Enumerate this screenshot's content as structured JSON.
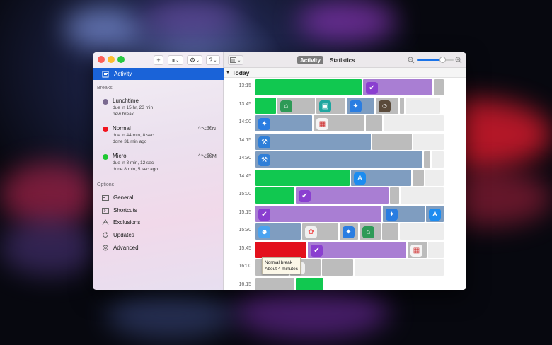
{
  "toolbar": {
    "add_label": "+",
    "pause_label": "⏸",
    "gear_label": "⚙",
    "help_label": "?",
    "chevron": "⌄"
  },
  "sidebar": {
    "activity_label": "Activity",
    "breaks_heading": "Breaks",
    "breaks": [
      {
        "name": "Lunchtime",
        "color": "#7a6a90",
        "line1": "due in 15 hr, 23 min",
        "line2": "new break",
        "shortcut": ""
      },
      {
        "name": "Normal",
        "color": "#f2141e",
        "line1": "due in 44 min, 8 sec",
        "line2": "done 31 min ago",
        "shortcut": "^⌥⌘N"
      },
      {
        "name": "Micro",
        "color": "#1fc832",
        "line1": "due in 8 min, 12 sec",
        "line2": "done 8 min, 5 sec ago",
        "shortcut": "^⌥⌘M"
      }
    ],
    "options_heading": "Options",
    "options": [
      {
        "label": "General",
        "icon": "general-icon"
      },
      {
        "label": "Shortcuts",
        "icon": "shortcuts-icon"
      },
      {
        "label": "Exclusions",
        "icon": "exclusions-icon"
      },
      {
        "label": "Updates",
        "icon": "updates-icon"
      },
      {
        "label": "Advanced",
        "icon": "advanced-icon"
      }
    ]
  },
  "main": {
    "tabs": [
      {
        "label": "Activity",
        "active": true
      },
      {
        "label": "Statistics",
        "active": false
      }
    ],
    "zoom_level": 0.7,
    "day_label": "Today",
    "colors": {
      "green": "#11c850",
      "purple": "#a97ed3",
      "steel": "#7f9dc0",
      "gray": "#bcbcbc",
      "light": "#ededed",
      "red": "#e3101c"
    },
    "rows": [
      {
        "time": "13:15",
        "segments": [
          {
            "c": "green",
            "w": 152
          },
          {
            "c": "purple",
            "w": 100,
            "icon": "tasks-icon"
          },
          {
            "c": "gray",
            "w": 16
          }
        ]
      },
      {
        "time": "13:45",
        "segments": [
          {
            "c": "green",
            "w": 31
          },
          {
            "c": "gray",
            "w": 55,
            "icon": "sourcetree-icon"
          },
          {
            "c": "gray",
            "w": 43,
            "icon": "terminal-icon"
          },
          {
            "c": "steel",
            "w": 41,
            "icon": "safari-icon"
          },
          {
            "c": "gray",
            "w": 34,
            "icon": "robot-icon"
          },
          {
            "c": "gray",
            "w": 8
          },
          {
            "c": "light",
            "w": 51
          }
        ]
      },
      {
        "time": "14:00",
        "segments": [
          {
            "c": "steel",
            "w": 82,
            "icon": "safari-icon"
          },
          {
            "c": "gray",
            "w": 74,
            "icon": "calendar-icon"
          },
          {
            "c": "gray",
            "w": 25
          },
          {
            "c": "light",
            "w": 87
          }
        ]
      },
      {
        "time": "14:15",
        "segments": [
          {
            "c": "steel",
            "w": 165,
            "icon": "xcode-icon"
          },
          {
            "c": "gray",
            "w": 58
          },
          {
            "c": "light",
            "w": 45
          }
        ]
      },
      {
        "time": "14:30",
        "segments": [
          {
            "c": "steel",
            "w": 238,
            "icon": "xcode-icon"
          },
          {
            "c": "gray",
            "w": 11
          },
          {
            "c": "light",
            "w": 19
          }
        ]
      },
      {
        "time": "14:45",
        "segments": [
          {
            "c": "green",
            "w": 135
          },
          {
            "c": "steel",
            "w": 87,
            "icon": "appstore-icon"
          },
          {
            "c": "gray",
            "w": 18
          },
          {
            "c": "light",
            "w": 28
          }
        ]
      },
      {
        "time": "15:00",
        "segments": [
          {
            "c": "green",
            "w": 57
          },
          {
            "c": "purple",
            "w": 133,
            "icon": "tasks-icon"
          },
          {
            "c": "gray",
            "w": 15
          },
          {
            "c": "light",
            "w": 63
          }
        ]
      },
      {
        "time": "15:15",
        "segments": [
          {
            "c": "purple",
            "w": 180,
            "icon": "tasks-icon"
          },
          {
            "c": "steel",
            "w": 61,
            "icon": "safari-icon"
          },
          {
            "c": "steel",
            "w": 27,
            "icon": "appstore-icon"
          }
        ]
      },
      {
        "time": "15:30",
        "segments": [
          {
            "c": "steel",
            "w": 66,
            "icon": "finder-icon"
          },
          {
            "c": "gray",
            "w": 53,
            "icon": "photos-icon"
          },
          {
            "c": "gray",
            "w": 28,
            "icon": "safari-icon"
          },
          {
            "c": "gray",
            "w": 32,
            "icon": "sourcetree-icon"
          },
          {
            "c": "gray",
            "w": 25
          },
          {
            "c": "light",
            "w": 64
          }
        ]
      },
      {
        "time": "15:45",
        "segments": [
          {
            "c": "red",
            "w": 74
          },
          {
            "c": "purple",
            "w": 141,
            "icon": "tasks-icon"
          },
          {
            "c": "gray",
            "w": 29,
            "icon": "calendar-icon"
          },
          {
            "c": "light",
            "w": 24
          }
        ]
      },
      {
        "time": "16:00",
        "segments": [
          {
            "c": "gray",
            "w": 49
          },
          {
            "c": "gray",
            "w": 45,
            "icon": "photos-icon"
          },
          {
            "c": "gray",
            "w": 46
          },
          {
            "c": "light",
            "w": 128
          }
        ]
      },
      {
        "time": "16:15",
        "segments": [
          {
            "c": "gray",
            "w": 57
          },
          {
            "c": "green",
            "w": 41
          }
        ]
      }
    ],
    "tooltip": {
      "line1": "Normal break",
      "line2": "About 4 minutes"
    }
  }
}
